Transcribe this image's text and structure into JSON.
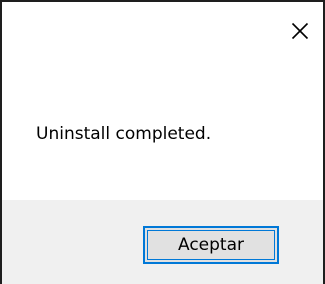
{
  "titlebar": {
    "close_icon": "close-icon"
  },
  "message": {
    "text": "Uninstall completed."
  },
  "buttons": {
    "ok_label": "Aceptar"
  },
  "colors": {
    "window_border": "#1e1e1e",
    "footer_background": "#f0f0f0",
    "button_background": "#e1e1e1",
    "button_focus_border": "#0078d7"
  }
}
